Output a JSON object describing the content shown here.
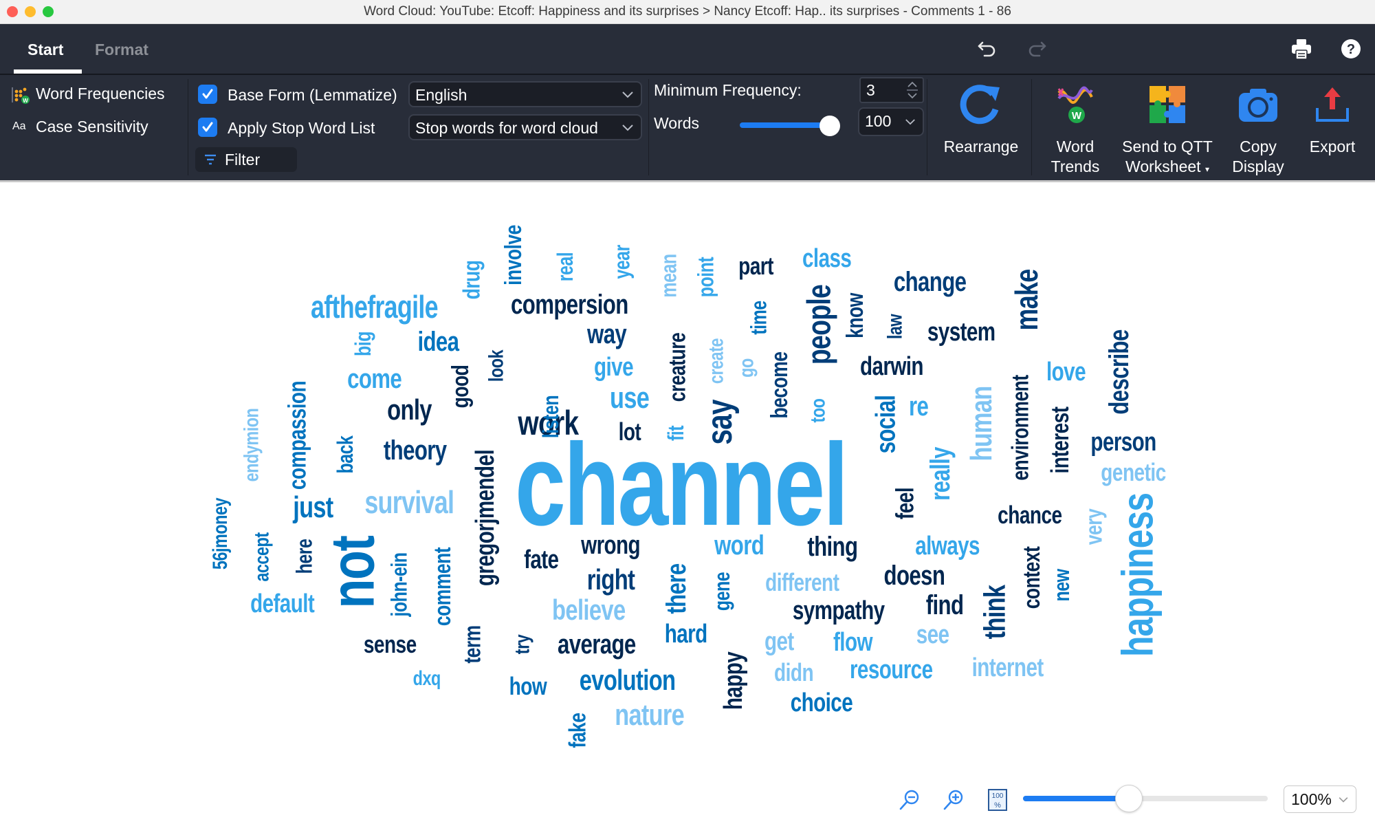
{
  "window": {
    "title": "Word Cloud: YouTube: Etcoff: Happiness and its surprises > Nancy Etcoff: Hap.. its surprises -  Comments 1 - 86"
  },
  "tabs": [
    {
      "label": "Start",
      "active": true
    },
    {
      "label": "Format",
      "active": false
    }
  ],
  "header_icons": {
    "undo": "undo-icon",
    "redo": "redo-icon",
    "print": "print-icon",
    "help": "help-icon"
  },
  "ribbon": {
    "word_frequencies": "Word Frequencies",
    "case_sensitivity": "Case Sensitivity",
    "case_icon_text": "Aa",
    "base_form": {
      "label": "Base Form (Lemmatize)",
      "checked": true
    },
    "language": {
      "value": "English"
    },
    "stop_words": {
      "label": "Apply Stop Word List",
      "checked": true
    },
    "stop_list": {
      "value": "Stop words for word cloud"
    },
    "filter": "Filter",
    "min_freq_label": "Minimum Frequency:",
    "min_freq_value": "3",
    "words_label": "Words",
    "words_slider_fraction": 0.95,
    "words_value": "100",
    "buttons": {
      "rearrange": "Rearrange",
      "word_trends_1": "Word",
      "word_trends_2": "Trends",
      "send_qtt_1": "Send to QTT",
      "send_qtt_2": "Worksheet",
      "copy_1": "Copy",
      "copy_2": "Display",
      "export": "Export"
    }
  },
  "colors": {
    "navy": "#00264f",
    "dark": "#003d78",
    "medium": "#0073be",
    "bright": "#34a6ea",
    "light": "#7fc4f3"
  },
  "word_cloud": [
    {
      "text": "channel",
      "color": "bright",
      "vertical": false
    },
    {
      "text": "not",
      "color": "medium",
      "vertical": true
    },
    {
      "text": "happiness",
      "color": "bright",
      "vertical": true
    },
    {
      "text": "work",
      "color": "navy",
      "vertical": false
    },
    {
      "text": "afthefragile",
      "color": "bright",
      "vertical": false
    },
    {
      "text": "compersion",
      "color": "navy",
      "vertical": false
    },
    {
      "text": "evolution",
      "color": "medium",
      "vertical": false
    },
    {
      "text": "nature",
      "color": "light",
      "vertical": false
    },
    {
      "text": "survival",
      "color": "light",
      "vertical": false
    },
    {
      "text": "change",
      "color": "dark",
      "vertical": false
    },
    {
      "text": "make",
      "color": "dark",
      "vertical": true
    },
    {
      "text": "people",
      "color": "dark",
      "vertical": true
    },
    {
      "text": "say",
      "color": "dark",
      "vertical": true
    },
    {
      "text": "gregorjmendel",
      "color": "navy",
      "vertical": true
    },
    {
      "text": "social",
      "color": "medium",
      "vertical": true
    },
    {
      "text": "person",
      "color": "dark",
      "vertical": false
    },
    {
      "text": "genetic",
      "color": "light",
      "vertical": false
    },
    {
      "text": "system",
      "color": "navy",
      "vertical": false
    },
    {
      "text": "darwin",
      "color": "navy",
      "vertical": false
    },
    {
      "text": "describe",
      "color": "dark",
      "vertical": true
    },
    {
      "text": "environment",
      "color": "navy",
      "vertical": true
    },
    {
      "text": "interest",
      "color": "navy",
      "vertical": true
    },
    {
      "text": "human",
      "color": "light",
      "vertical": true
    },
    {
      "text": "love",
      "color": "bright",
      "vertical": false
    },
    {
      "text": "re",
      "color": "bright",
      "vertical": false
    },
    {
      "text": "really",
      "color": "bright",
      "vertical": true
    },
    {
      "text": "feel",
      "color": "navy",
      "vertical": true
    },
    {
      "text": "chance",
      "color": "navy",
      "vertical": false
    },
    {
      "text": "very",
      "color": "light",
      "vertical": true
    },
    {
      "text": "always",
      "color": "bright",
      "vertical": false
    },
    {
      "text": "doesn",
      "color": "navy",
      "vertical": false
    },
    {
      "text": "find",
      "color": "navy",
      "vertical": false
    },
    {
      "text": "think",
      "color": "dark",
      "vertical": true
    },
    {
      "text": "context",
      "color": "navy",
      "vertical": true
    },
    {
      "text": "new",
      "color": "medium",
      "vertical": true
    },
    {
      "text": "see",
      "color": "light",
      "vertical": false
    },
    {
      "text": "internet",
      "color": "light",
      "vertical": false
    },
    {
      "text": "resource",
      "color": "bright",
      "vertical": false
    },
    {
      "text": "sympathy",
      "color": "navy",
      "vertical": false
    },
    {
      "text": "different",
      "color": "light",
      "vertical": false
    },
    {
      "text": "thing",
      "color": "navy",
      "vertical": false
    },
    {
      "text": "word",
      "color": "bright",
      "vertical": false
    },
    {
      "text": "gene",
      "color": "medium",
      "vertical": true
    },
    {
      "text": "there",
      "color": "medium",
      "vertical": true
    },
    {
      "text": "hard",
      "color": "medium",
      "vertical": false
    },
    {
      "text": "get",
      "color": "light",
      "vertical": false
    },
    {
      "text": "flow",
      "color": "bright",
      "vertical": false
    },
    {
      "text": "didn",
      "color": "light",
      "vertical": false
    },
    {
      "text": "choice",
      "color": "medium",
      "vertical": false
    },
    {
      "text": "happy",
      "color": "navy",
      "vertical": true
    },
    {
      "text": "wrong",
      "color": "navy",
      "vertical": false
    },
    {
      "text": "right",
      "color": "dark",
      "vertical": false
    },
    {
      "text": "believe",
      "color": "light",
      "vertical": false
    },
    {
      "text": "average",
      "color": "navy",
      "vertical": false
    },
    {
      "text": "fate",
      "color": "navy",
      "vertical": false
    },
    {
      "text": "try",
      "color": "dark",
      "vertical": true
    },
    {
      "text": "how",
      "color": "medium",
      "vertical": false
    },
    {
      "text": "fake",
      "color": "medium",
      "vertical": true
    },
    {
      "text": "term",
      "color": "dark",
      "vertical": true
    },
    {
      "text": "dxq",
      "color": "bright",
      "vertical": false
    },
    {
      "text": "sense",
      "color": "navy",
      "vertical": false
    },
    {
      "text": "comment",
      "color": "medium",
      "vertical": true
    },
    {
      "text": "john-ein",
      "color": "medium",
      "vertical": true
    },
    {
      "text": "here",
      "color": "dark",
      "vertical": true
    },
    {
      "text": "default",
      "color": "bright",
      "vertical": false
    },
    {
      "text": "accept",
      "color": "medium",
      "vertical": true
    },
    {
      "text": "56jmoney",
      "color": "medium",
      "vertical": true
    },
    {
      "text": "endymion",
      "color": "light",
      "vertical": true
    },
    {
      "text": "compassion",
      "color": "medium",
      "vertical": true
    },
    {
      "text": "just",
      "color": "medium",
      "vertical": false
    },
    {
      "text": "back",
      "color": "medium",
      "vertical": true
    },
    {
      "text": "theory",
      "color": "dark",
      "vertical": false
    },
    {
      "text": "only",
      "color": "navy",
      "vertical": false
    },
    {
      "text": "come",
      "color": "bright",
      "vertical": false
    },
    {
      "text": "big",
      "color": "bright",
      "vertical": true
    },
    {
      "text": "idea",
      "color": "medium",
      "vertical": false
    },
    {
      "text": "good",
      "color": "navy",
      "vertical": true
    },
    {
      "text": "look",
      "color": "dark",
      "vertical": true
    },
    {
      "text": "listen",
      "color": "medium",
      "vertical": true
    },
    {
      "text": "drug",
      "color": "bright",
      "vertical": true
    },
    {
      "text": "involve",
      "color": "medium",
      "vertical": true
    },
    {
      "text": "real",
      "color": "bright",
      "vertical": true
    },
    {
      "text": "year",
      "color": "bright",
      "vertical": true
    },
    {
      "text": "mean",
      "color": "light",
      "vertical": true
    },
    {
      "text": "point",
      "color": "bright",
      "vertical": true
    },
    {
      "text": "part",
      "color": "navy",
      "vertical": false
    },
    {
      "text": "class",
      "color": "bright",
      "vertical": false
    },
    {
      "text": "way",
      "color": "dark",
      "vertical": false
    },
    {
      "text": "give",
      "color": "bright",
      "vertical": false
    },
    {
      "text": "use",
      "color": "bright",
      "vertical": false
    },
    {
      "text": "lot",
      "color": "navy",
      "vertical": false
    },
    {
      "text": "fit",
      "color": "bright",
      "vertical": true
    },
    {
      "text": "creature",
      "color": "navy",
      "vertical": true
    },
    {
      "text": "create",
      "color": "light",
      "vertical": true
    },
    {
      "text": "go",
      "color": "light",
      "vertical": true
    },
    {
      "text": "time",
      "color": "medium",
      "vertical": true
    },
    {
      "text": "become",
      "color": "dark",
      "vertical": true
    },
    {
      "text": "too",
      "color": "bright",
      "vertical": true
    },
    {
      "text": "know",
      "color": "dark",
      "vertical": true
    },
    {
      "text": "law",
      "color": "dark",
      "vertical": true
    }
  ],
  "zoom": {
    "zoom_out": "zoom-out-icon",
    "zoom_in": "zoom-in-icon",
    "actual_size": "actual-size-icon",
    "actual_size_text": "100 %",
    "slider_fraction": 0.43,
    "value": "100%"
  }
}
